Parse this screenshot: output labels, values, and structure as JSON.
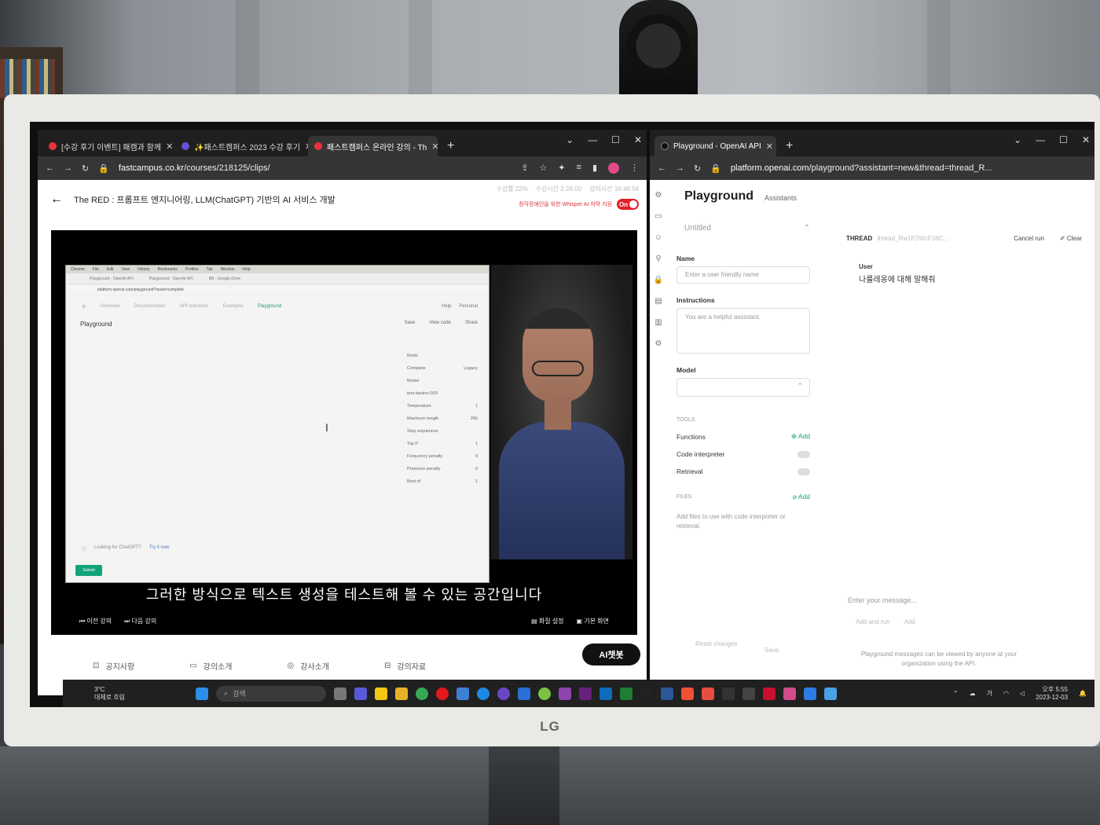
{
  "left_browser": {
    "tabs": [
      {
        "label": "[수강 후기 이벤트] 패캠과 함께"
      },
      {
        "label": "✨패스트캠퍼스 2023 수강 후기"
      },
      {
        "label": "패스트캠퍼스 온라인 강의 - Th"
      }
    ],
    "url_host": "fastcampus.co.kr",
    "url_path": "/courses/218125/clips/",
    "course_title": "The RED : 프롬프트 엔지니어링, LLM(ChatGPT) 기반의 AI 서비스 개발",
    "progress": "수강률 22%",
    "study_time": "수강시간 2:26:00",
    "lecture_time": "강의시간 16:48:58",
    "caption_label": "청각장애인을 위한 Whisper AI 자막 지원",
    "caption_toggle": "On",
    "subtitle": "그러한 방식으로 텍스트 생성을 테스트해 볼 수 있는 공간입니다",
    "controls": {
      "prev": "이전 강의",
      "next": "다음 강의",
      "quality": "화질 설정",
      "view": "기본 화면"
    },
    "nav": [
      "공지사항",
      "강의소개",
      "강사소개",
      "강의자료"
    ],
    "chatbot": "AI챗봇"
  },
  "inner_screenshot": {
    "menubar": [
      "Chrome",
      "File",
      "Edit",
      "View",
      "History",
      "Bookmarks",
      "Profiles",
      "Tab",
      "Window",
      "Help"
    ],
    "tabs": [
      "Playground - OpenAI API",
      "Playground - OpenAI API",
      "BB - Google Drive"
    ],
    "url": "platform.openai.com/playground?mode=complete",
    "nav": [
      "Overview",
      "Documentation",
      "API reference",
      "Examples",
      "Playground"
    ],
    "nav_right": [
      "Help",
      "Personal"
    ],
    "title": "Playground",
    "actions": [
      "Save",
      "View code",
      "Share"
    ],
    "side": [
      {
        "label": "Mode",
        "value": ""
      },
      {
        "label": "Complete",
        "value": "Legacy"
      },
      {
        "label": "Model",
        "value": ""
      },
      {
        "label": "text-davinci-003",
        "value": ""
      },
      {
        "label": "Temperature",
        "value": "1"
      },
      {
        "label": "Maximum length",
        "value": "256"
      },
      {
        "label": "Stop sequences",
        "value": ""
      },
      {
        "label": "Top P",
        "value": "1"
      },
      {
        "label": "Frequency penalty",
        "value": "0"
      },
      {
        "label": "Presence penalty",
        "value": "0"
      },
      {
        "label": "Best of",
        "value": "1"
      }
    ],
    "footer_text": "Looking for ChatGPT?",
    "footer_link": "Try it now",
    "submit": "Submit"
  },
  "right_browser": {
    "tab": "Playground - OpenAI API",
    "url_host": "platform.openai.com",
    "url_path": "/playground?assistant=new&thread=thread_R...",
    "title": "Playground",
    "mode": "Assistants",
    "assistant_name": "Untitled",
    "name_label": "Name",
    "name_placeholder": "Enter a user friendly name",
    "instructions_label": "Instructions",
    "instructions_placeholder": "You are a helpful assistant.",
    "model_label": "Model",
    "tools_label": "TOOLS",
    "tools": [
      {
        "label": "Functions",
        "action": "Add"
      },
      {
        "label": "Code interpreter",
        "action": ""
      },
      {
        "label": "Retrieval",
        "action": ""
      }
    ],
    "files_label": "FILES",
    "files_add": "Add",
    "files_help": "Add files to use with code interpreter or retrieval.",
    "thread_label": "THREAD",
    "thread_id": "thread_Rw1P2WcF18C...",
    "cancel_run": "Cancel run",
    "clear": "Clear",
    "user_role": "User",
    "user_message": "나룰레옹에 대해 말해줘",
    "message_placeholder": "Enter your message...",
    "add_and_run": "Add and run",
    "add": "Add",
    "reset": "Reset changes",
    "save": "Save",
    "notice": "Playground messages can be viewed by anyone at your organization using the API."
  },
  "taskbar": {
    "weather_temp": "3°C",
    "weather_desc": "대체로 흐림",
    "search": "검색",
    "time": "오후 5:55",
    "date": "2023-12-03",
    "ime": "가"
  },
  "monitor_logo": "LG"
}
